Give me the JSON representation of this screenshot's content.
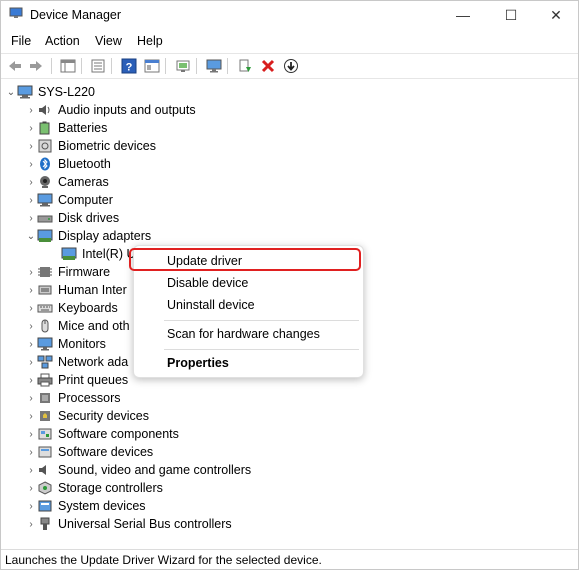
{
  "window": {
    "title": "Device Manager",
    "minimize_glyph": "—",
    "maximize_glyph": "☐",
    "close_glyph": "✕"
  },
  "menu": [
    "File",
    "Action",
    "View",
    "Help"
  ],
  "tree": {
    "root": "SYS-L220",
    "items": [
      {
        "label": "Audio inputs and outputs",
        "icon": "speaker-icon"
      },
      {
        "label": "Batteries",
        "icon": "battery-icon"
      },
      {
        "label": "Biometric devices",
        "icon": "biometric-icon"
      },
      {
        "label": "Bluetooth",
        "icon": "bluetooth-icon"
      },
      {
        "label": "Cameras",
        "icon": "camera-icon"
      },
      {
        "label": "Computer",
        "icon": "computer-icon"
      },
      {
        "label": "Disk drives",
        "icon": "disk-icon"
      },
      {
        "label": "Display adapters",
        "icon": "display-adapter-icon",
        "expanded": true
      },
      {
        "label": "Intel(R) U",
        "icon": "display-adapter-icon",
        "child": true
      },
      {
        "label": "Firmware",
        "icon": "firmware-icon"
      },
      {
        "label": "Human Inter",
        "icon": "hid-icon"
      },
      {
        "label": "Keyboards",
        "icon": "keyboard-icon"
      },
      {
        "label": "Mice and oth",
        "icon": "mouse-icon"
      },
      {
        "label": "Monitors",
        "icon": "monitor-icon"
      },
      {
        "label": "Network ada",
        "icon": "network-icon"
      },
      {
        "label": "Print queues",
        "icon": "printer-icon"
      },
      {
        "label": "Processors",
        "icon": "processor-icon"
      },
      {
        "label": "Security devices",
        "icon": "security-icon"
      },
      {
        "label": "Software components",
        "icon": "software-component-icon"
      },
      {
        "label": "Software devices",
        "icon": "software-device-icon"
      },
      {
        "label": "Sound, video and game controllers",
        "icon": "sound-icon"
      },
      {
        "label": "Storage controllers",
        "icon": "storage-icon"
      },
      {
        "label": "System devices",
        "icon": "system-icon"
      },
      {
        "label": "Universal Serial Bus controllers",
        "icon": "usb-icon"
      }
    ]
  },
  "context_menu": {
    "update_driver": "Update driver",
    "disable_device": "Disable device",
    "uninstall_device": "Uninstall device",
    "scan": "Scan for hardware changes",
    "properties": "Properties"
  },
  "status": "Launches the Update Driver Wizard for the selected device.",
  "colors": {
    "highlight_border": "#e02020",
    "accent": "#1e6fc8",
    "delete_red": "#d81e1e"
  }
}
